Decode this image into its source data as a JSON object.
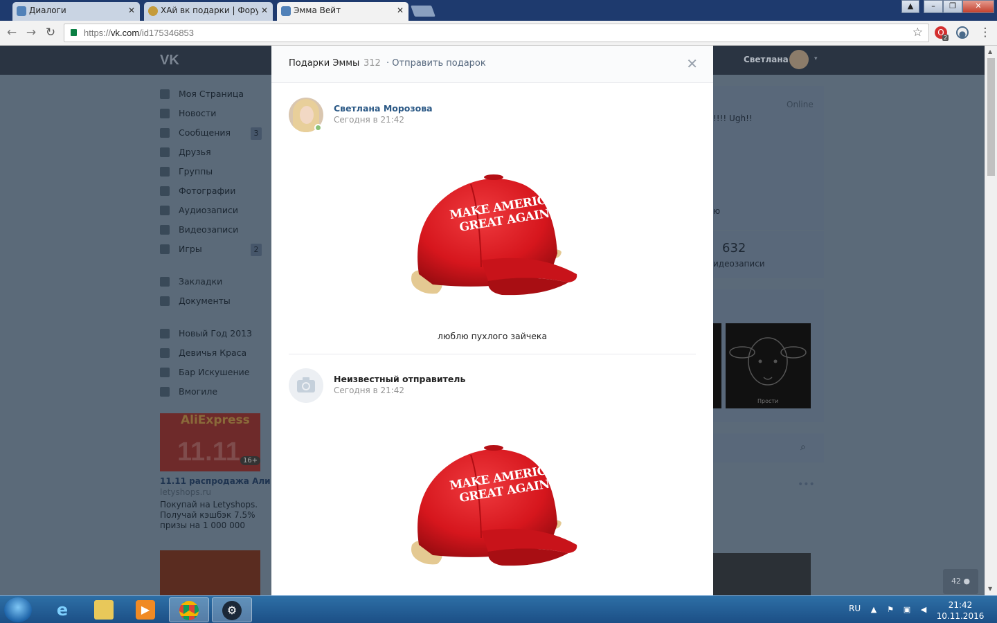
{
  "browser": {
    "tabs": [
      {
        "title": "Диалоги",
        "active": false
      },
      {
        "title": "ХАй вк подарки | Форум",
        "active": false
      },
      {
        "title": "Эмма Вейт",
        "active": true
      }
    ],
    "url_prefix": "https://",
    "url_host": "vk.com",
    "url_path": "/id175346853",
    "extension_badge": "2"
  },
  "vk": {
    "header_user": "Светлана",
    "sidebar": [
      {
        "label": "Моя Страница",
        "icon": "home-icon"
      },
      {
        "label": "Новости",
        "icon": "news-icon"
      },
      {
        "label": "Сообщения",
        "icon": "messages-icon",
        "badge": "3"
      },
      {
        "label": "Друзья",
        "icon": "friends-icon"
      },
      {
        "label": "Группы",
        "icon": "groups-icon"
      },
      {
        "label": "Фотографии",
        "icon": "camera-icon"
      },
      {
        "label": "Аудиозаписи",
        "icon": "music-icon"
      },
      {
        "label": "Видеозаписи",
        "icon": "video-icon"
      },
      {
        "label": "Игры",
        "icon": "gamepad-icon",
        "badge": "2"
      },
      {
        "label": "Закладки",
        "icon": "star-icon"
      },
      {
        "label": "Документы",
        "icon": "document-icon"
      },
      {
        "label": "Новый Год 2013",
        "icon": "app-grid-icon"
      },
      {
        "label": "Девичья Краса",
        "icon": "anchor-icon"
      },
      {
        "label": "Бар Искушение",
        "icon": "app-grid-icon"
      },
      {
        "label": "Вмогиле",
        "icon": "anchor-icon"
      }
    ],
    "ad": {
      "brand": "AliExpress",
      "banner_number": "11.11",
      "age": "16+",
      "title": "11.11 распродажа Али",
      "domain": "letyshops.ru",
      "text": "Покупай на Letyshops. Получай кэшбэк 7.5% призы на 1 000 000"
    },
    "profile": {
      "online": "Online",
      "status_fragment": "!!!! Ugh!!",
      "partial_text": "ю",
      "videos_count": "632",
      "videos_label": "идеозаписи",
      "photo_caption": "Прости"
    },
    "page_counter": "42"
  },
  "modal": {
    "title": "Подарки Эммы",
    "count": "312",
    "send_gift": "· Отправить подарок",
    "gifts": [
      {
        "sender": "Светлана Морозова",
        "time": "Сегодня в 21:42",
        "caption": "люблю пухлого зайчека",
        "hat_text_1": "MAKE AMERICA",
        "hat_text_2": "GREAT AGAIN"
      },
      {
        "sender": "Неизвестный отправитель",
        "time": "Сегодня в 21:42",
        "hat_text_1": "MAKE AMERICA",
        "hat_text_2": "GREAT AGAIN"
      }
    ]
  },
  "taskbar": {
    "lang": "RU",
    "time": "21:42",
    "date": "10.11.2016"
  },
  "colors": {
    "vk_link": "#2a5885",
    "cap_red": "#d6161d",
    "online_green": "#8ac176"
  }
}
